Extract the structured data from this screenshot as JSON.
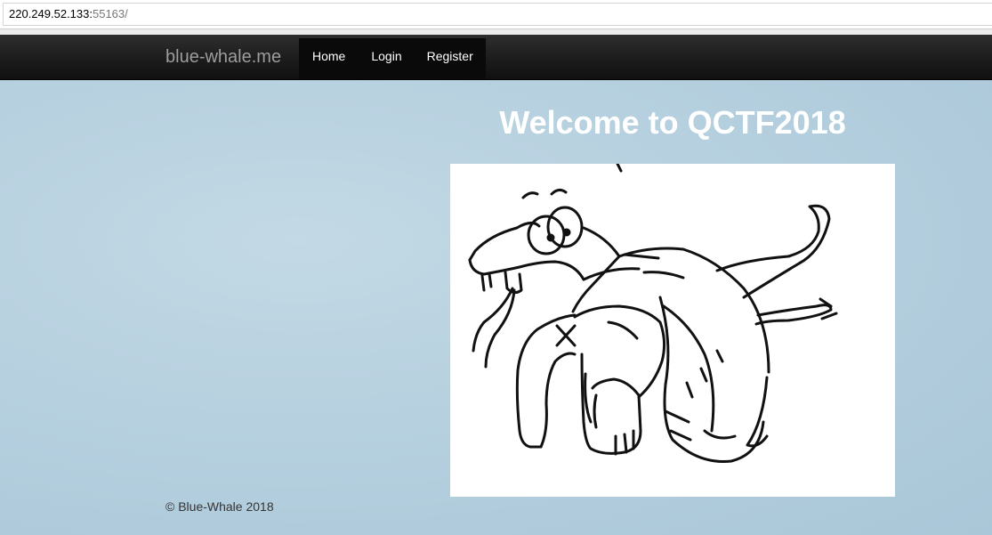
{
  "browser": {
    "url_host": "220.249.52.133:",
    "url_port": "55163/"
  },
  "navbar": {
    "brand": "blue-whale.me",
    "items": [
      {
        "label": "Home"
      },
      {
        "label": "Login"
      },
      {
        "label": "Register"
      }
    ]
  },
  "main": {
    "title": "Welcome to QCTF2018",
    "image": "snake-coiled-around-elephant-sketch"
  },
  "footer": {
    "copyright": "© Blue-Whale 2018"
  }
}
